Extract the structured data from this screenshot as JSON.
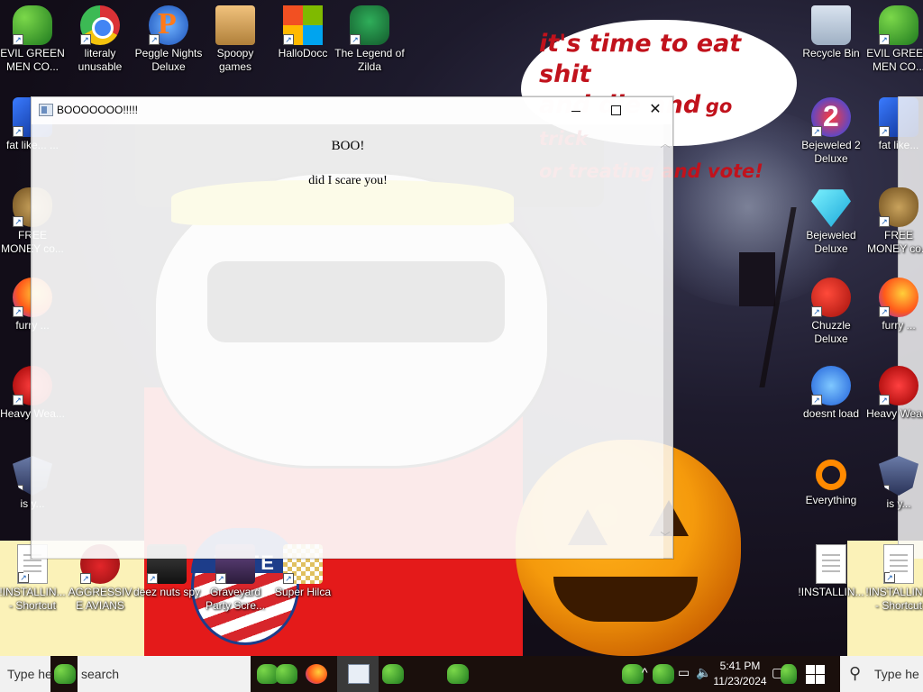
{
  "desktop": {
    "bubble": {
      "line1": "it's time to eat shit",
      "line2a": "and die and",
      "line2b": "go trick",
      "line3": "or treating and vote!"
    },
    "badge_text": "VOTE",
    "icons_top": [
      {
        "label": "EVIL GREEN MEN CO...",
        "icon": "green-men-icon"
      },
      {
        "label": "literaly unusable",
        "icon": "chrome-icon"
      },
      {
        "label": "Peggle Nights Deluxe",
        "icon": "peggle-icon"
      },
      {
        "label": "Spoopy games",
        "icon": "spoopy-games-icon"
      },
      {
        "label": "HalloDocc",
        "icon": "microsoft-icon"
      },
      {
        "label": "The Legend of Zilda",
        "icon": "zelda-icon"
      }
    ],
    "icons_right": [
      {
        "label": "Recycle Bin",
        "icon": "recycle-bin-icon"
      },
      {
        "label": "Bejeweled 2 Deluxe",
        "icon": "bejeweled2-icon"
      },
      {
        "label": "Bejeweled Deluxe",
        "icon": "bejeweled-icon"
      },
      {
        "label": "Chuzzle Deluxe",
        "icon": "chuzzle-icon"
      },
      {
        "label": "doesnt load",
        "icon": "thunderbird-icon"
      },
      {
        "label": "Everything",
        "icon": "everything-icon"
      },
      {
        "label": "!INSTALLIN...",
        "icon": "document-icon"
      }
    ],
    "icons_far_right": [
      {
        "label": "EVIL GREEN MEN CO...",
        "icon": "green-men-icon"
      },
      {
        "label": "fat like...",
        "icon": "blue-icon"
      },
      {
        "label": "FREE MONEY co...",
        "icon": "money-bag-icon"
      },
      {
        "label": "furry ...",
        "icon": "firefox-icon"
      },
      {
        "label": "Heavy Wea...",
        "icon": "red-icon"
      },
      {
        "label": "is y...",
        "icon": "shield-icon"
      },
      {
        "label": "!INSTALLIN... - Shortcut",
        "icon": "document-icon"
      }
    ],
    "icons_left": [
      {
        "label": "fat like... ...",
        "icon": "blue-icon"
      },
      {
        "label": "FREE MONEY co...",
        "icon": "money-bag-icon"
      },
      {
        "label": "furry ...",
        "icon": "firefox-icon"
      },
      {
        "label": "Heavy Wea...",
        "icon": "red-icon"
      },
      {
        "label": "is y...",
        "icon": "shield-icon"
      }
    ],
    "icons_bottom": [
      {
        "label": "!INSTALLIN... - Shortcut",
        "icon": "document-icon"
      },
      {
        "label": "AGGRESSIVE AVIANS",
        "icon": "angry-bird-icon"
      },
      {
        "label": "deez nuts spy",
        "icon": "dark-app-icon"
      },
      {
        "label": "Graveyard Party Scre...",
        "icon": "graveyard-icon"
      },
      {
        "label": "Super Hilca",
        "icon": "pixel-icon"
      }
    ]
  },
  "window": {
    "title": "BOOOOOOO!!!!!",
    "close_glyph": "✕",
    "heading": "BOO!",
    "message": "did I scare you!"
  },
  "taskbar": {
    "search_left": "Type he",
    "search_mid": "search",
    "search_right": "Type he",
    "time": "5:41 PM",
    "date": "11/23/2024"
  }
}
